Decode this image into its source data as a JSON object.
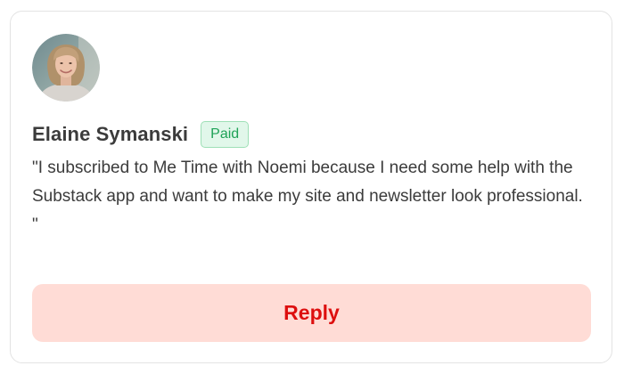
{
  "comment": {
    "author_name": "Elaine Symanski",
    "badge_label": "Paid",
    "message": "\"I subscribed to Me Time with Noemi because I need some help with the Substack app and want to make my site and newsletter look professional. \""
  },
  "actions": {
    "reply_label": "Reply"
  },
  "colors": {
    "accent_text": "#dd0f0f",
    "accent_background": "#ffdcd6",
    "badge_text": "#1fa257",
    "badge_background": "#e1f7ea"
  }
}
